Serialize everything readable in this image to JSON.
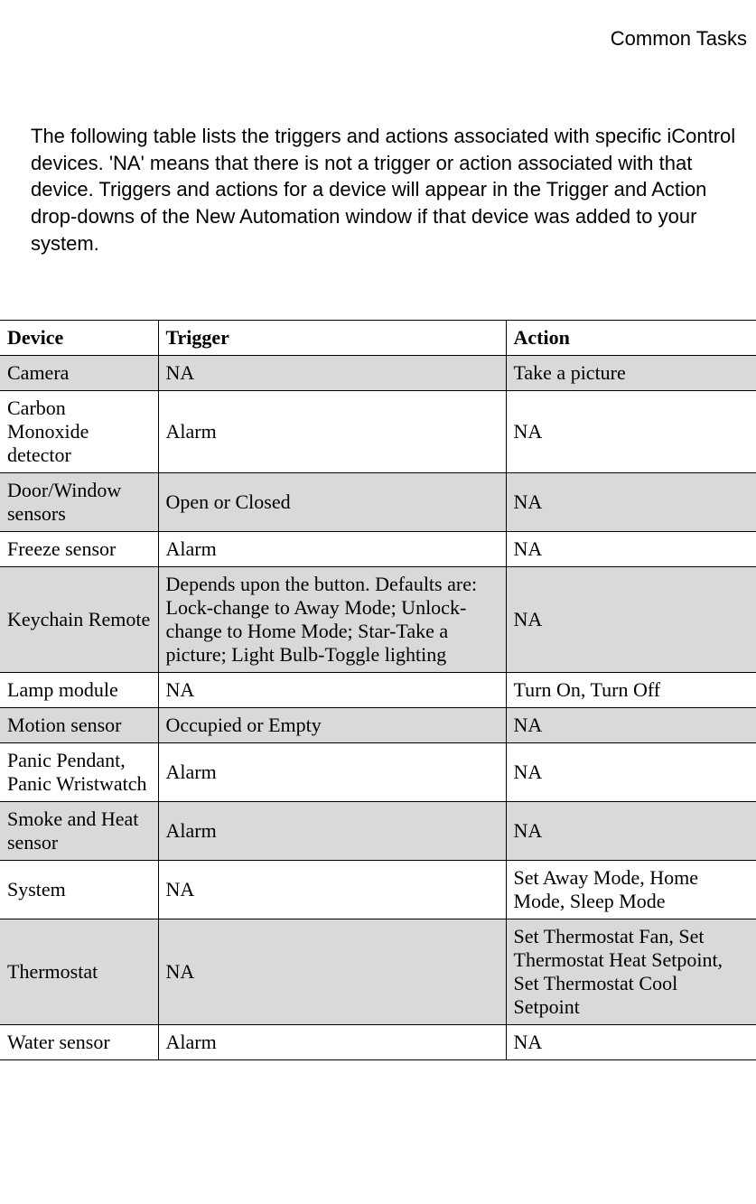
{
  "header": {
    "title": "Common Tasks"
  },
  "intro": "The following table lists the triggers and actions associated with specific iControl devices. 'NA' means that there is not a trigger or action associated with that device. Triggers and actions for a device will appear in the Trigger and Action drop-downs of the New Automation window if that device was added to your system.",
  "table": {
    "headers": [
      "Device",
      "Trigger",
      "Action"
    ],
    "rows": [
      {
        "shaded": true,
        "cells": [
          "Camera",
          "NA",
          "Take a picture"
        ]
      },
      {
        "shaded": false,
        "cells": [
          "Carbon Monoxide detector",
          "Alarm",
          "NA"
        ]
      },
      {
        "shaded": true,
        "cells": [
          "Door/Window sensors",
          "Open or Closed",
          "NA"
        ]
      },
      {
        "shaded": false,
        "cells": [
          "Freeze sensor",
          "Alarm",
          "NA"
        ]
      },
      {
        "shaded": true,
        "cells": [
          "Keychain Remote",
          "Depends upon the button. Defaults are: Lock-change to Away Mode; Unlock-change to Home Mode; Star-Take a picture; Light Bulb-Toggle lighting",
          "NA"
        ]
      },
      {
        "shaded": false,
        "cells": [
          "Lamp module",
          "NA",
          "Turn On, Turn Off"
        ]
      },
      {
        "shaded": true,
        "cells": [
          "Motion sensor",
          "Occupied or Empty",
          "NA"
        ]
      },
      {
        "shaded": false,
        "cells": [
          "Panic Pendant, Panic Wristwatch",
          "Alarm",
          "NA"
        ]
      },
      {
        "shaded": true,
        "cells": [
          "Smoke and Heat sensor",
          "Alarm",
          "NA"
        ]
      },
      {
        "shaded": false,
        "cells": [
          "System",
          "NA",
          "Set Away Mode, Home Mode, Sleep Mode"
        ]
      },
      {
        "shaded": true,
        "cells": [
          "Thermostat",
          "NA",
          "Set Thermostat Fan, Set Thermostat Heat Setpoint, Set Thermostat Cool Setpoint"
        ]
      },
      {
        "shaded": false,
        "cells": [
          "Water sensor",
          "Alarm",
          "NA"
        ]
      }
    ]
  }
}
